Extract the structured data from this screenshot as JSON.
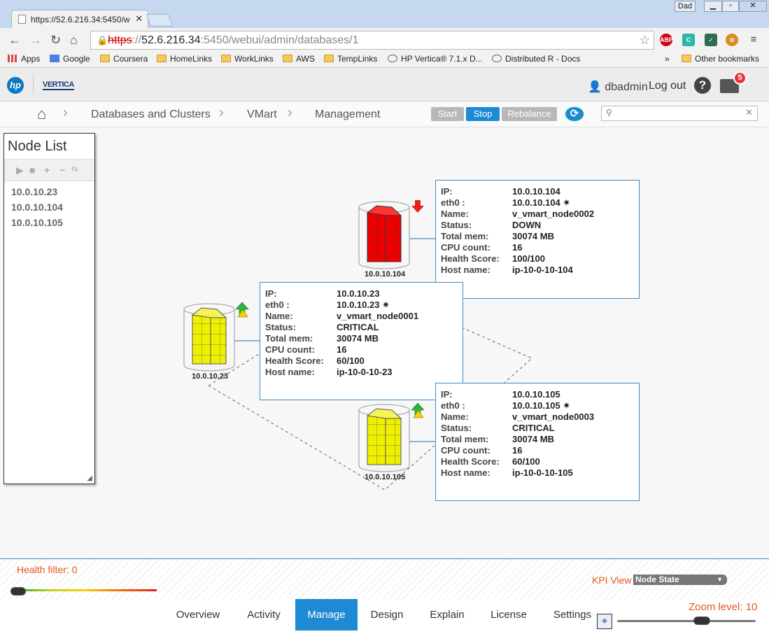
{
  "browser": {
    "tab_title": "https://52.6.216.34:5450/w",
    "user_button": "Dad",
    "url_scheme": "https",
    "url_host": "52.6.216.34",
    "url_rest": ":5450/webui/admin/databases/1",
    "bookmarks": [
      "Apps",
      "Google",
      "Coursera",
      "HomeLinks",
      "WorkLinks",
      "AWS",
      "TempLinks",
      "HP Vertica® 7.1.x D...",
      "Distributed R - Docs"
    ],
    "overflow": "»",
    "other_bookmarks": "Other bookmarks"
  },
  "header": {
    "hp_logo": "hp",
    "vertica_logo": "VERTICA",
    "username": "dbadmin",
    "logout_label": "Log out",
    "notification_count": "5"
  },
  "breadcrumb": {
    "items": [
      "Databases and Clusters",
      "VMart",
      "Management"
    ]
  },
  "actions": {
    "start": "Start",
    "stop": "Stop",
    "rebalance": "Rebalance"
  },
  "search": {
    "placeholder": ""
  },
  "node_list": {
    "title": "Node List",
    "items": [
      "10.0.10.23",
      "10.0.10.104",
      "10.0.10.105"
    ]
  },
  "nodes": [
    {
      "label": "10.0.10.23",
      "status_color": "#eef000",
      "fields": [
        {
          "k": "IP:",
          "v": "10.0.10.23"
        },
        {
          "k": "eth0 :",
          "v": "10.0.10.23 ✷"
        },
        {
          "k": "Name:",
          "v": "v_vmart_node0001"
        },
        {
          "k": "Status:",
          "v": "CRITICAL"
        },
        {
          "k": "Total mem:",
          "v": "30074 MB"
        },
        {
          "k": "CPU count:",
          "v": "16"
        },
        {
          "k": "Health Score:",
          "v": "60/100"
        },
        {
          "k": "Host name:",
          "v": "ip-10-0-10-23"
        }
      ]
    },
    {
      "label": "10.0.10.104",
      "status_color": "#ee0000",
      "fields": [
        {
          "k": "IP:",
          "v": "10.0.10.104"
        },
        {
          "k": "eth0 :",
          "v": "10.0.10.104 ✷"
        },
        {
          "k": "Name:",
          "v": "v_vmart_node0002"
        },
        {
          "k": "Status:",
          "v": "DOWN"
        },
        {
          "k": "Total mem:",
          "v": "30074 MB"
        },
        {
          "k": "CPU count:",
          "v": "16"
        },
        {
          "k": "Health Score:",
          "v": "100/100"
        },
        {
          "k": "Host name:",
          "v": "ip-10-0-10-104"
        }
      ]
    },
    {
      "label": "10.0.10.105",
      "status_color": "#eef000",
      "fields": [
        {
          "k": "IP:",
          "v": "10.0.10.105"
        },
        {
          "k": "eth0 :",
          "v": "10.0.10.105 ✷"
        },
        {
          "k": "Name:",
          "v": "v_vmart_node0003"
        },
        {
          "k": "Status:",
          "v": "CRITICAL"
        },
        {
          "k": "Total mem:",
          "v": "30074 MB"
        },
        {
          "k": "CPU count:",
          "v": "16"
        },
        {
          "k": "Health Score:",
          "v": "60/100"
        },
        {
          "k": "Host name:",
          "v": "ip-10-0-10-105"
        }
      ]
    }
  ],
  "health_filter": {
    "label": "Health filter: 0",
    "value": 0
  },
  "kpi": {
    "label": "KPI View",
    "selected": "Node State"
  },
  "tabs": [
    "Overview",
    "Activity",
    "Manage",
    "Design",
    "Explain",
    "License",
    "Settings"
  ],
  "active_tab": "Manage",
  "zoom": {
    "label": "Zoom level: 10",
    "value": 10
  },
  "colors": {
    "accent": "#1f8ad4",
    "orange": "#e05a1c",
    "down": "#ee0000",
    "critical": "#eef000",
    "border": "#3c8dc7"
  }
}
